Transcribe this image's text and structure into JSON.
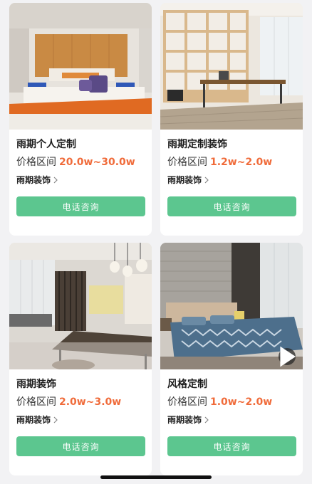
{
  "cards": [
    {
      "title": "雨期个人定制",
      "price_label": "价格区间",
      "price_value": "20.0w~30.0w",
      "tag": "雨期装饰",
      "button": "电话咨询",
      "image_desc_icon": "bedroom-photo"
    },
    {
      "title": "雨期定制装饰",
      "price_label": "价格区间",
      "price_value": "1.2w~2.0w",
      "tag": "雨期装饰",
      "button": "电话咨询",
      "image_desc_icon": "study-room-photo"
    },
    {
      "title": "雨期装饰",
      "price_label": "价格区间",
      "price_value": "2.0w~3.0w",
      "tag": "雨期装饰",
      "button": "电话咨询",
      "image_desc_icon": "dining-room-photo"
    },
    {
      "title": "风格定制",
      "price_label": "价格区间",
      "price_value": "1.0w~2.0w",
      "tag": "雨期装饰",
      "button": "电话咨询",
      "image_desc_icon": "bedroom-photo"
    }
  ],
  "colors": {
    "accent_price": "#f06b3a",
    "button_green": "#5cc68f",
    "background": "#f2f2f4"
  }
}
